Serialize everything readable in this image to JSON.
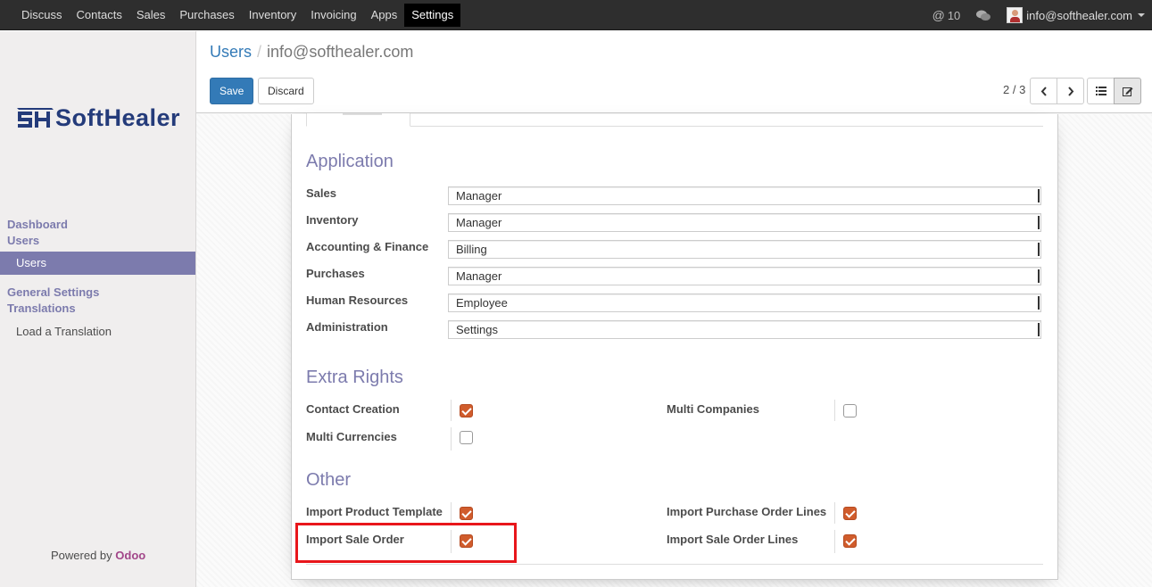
{
  "navbar": {
    "menu": [
      "Discuss",
      "Contacts",
      "Sales",
      "Purchases",
      "Inventory",
      "Invoicing",
      "Apps",
      "Settings"
    ],
    "active": "Settings",
    "notifications": "10",
    "user": "info@softhealer.com"
  },
  "sidebar": {
    "logo_text": "SoftHealer",
    "dashboard": "Dashboard",
    "users_section": "Users",
    "users_item": "Users",
    "general_settings": "General Settings",
    "translations": "Translations",
    "load_translation": "Load a Translation",
    "powered_prefix": "Powered by",
    "powered_brand": "Odoo"
  },
  "control": {
    "breadcrumb_parent": "Users",
    "breadcrumb_current": "info@softhealer.com",
    "save": "Save",
    "discard": "Discard",
    "pager": "2 / 3"
  },
  "form": {
    "application_title": "Application",
    "application_fields": [
      {
        "label": "Sales",
        "value": "Manager"
      },
      {
        "label": "Inventory",
        "value": "Manager"
      },
      {
        "label": "Accounting & Finance",
        "value": "Billing"
      },
      {
        "label": "Purchases",
        "value": "Manager"
      },
      {
        "label": "Human Resources",
        "value": "Employee"
      },
      {
        "label": "Administration",
        "value": "Settings"
      }
    ],
    "extra_rights_title": "Extra Rights",
    "extra_rights": [
      {
        "label": "Contact Creation",
        "checked": true
      },
      {
        "label": "Multi Companies",
        "checked": false
      },
      {
        "label": "Multi Currencies",
        "checked": false
      }
    ],
    "other_title": "Other",
    "other": [
      {
        "label": "Import Product Template",
        "checked": true
      },
      {
        "label": "Import Purchase Order Lines",
        "checked": true
      },
      {
        "label": "Import Sale Order",
        "checked": true
      },
      {
        "label": "Import Sale Order Lines",
        "checked": true
      }
    ]
  },
  "colors": {
    "accent": "#7c7bad",
    "primary": "#337ab7",
    "checkbox": "#d05c2c",
    "highlight": "#e8161b"
  }
}
